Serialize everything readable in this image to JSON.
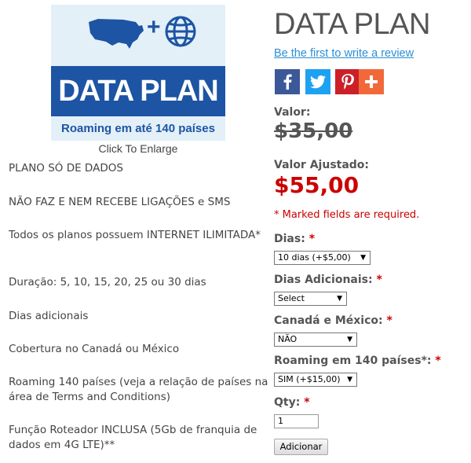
{
  "product_image": {
    "banner_title": "DATA PLAN",
    "banner_subtitle": "Roaming em até 140 países",
    "plus_symbol": "+",
    "enlarge_label": "Click To Enlarge",
    "colors": {
      "blue": "#1d54a4",
      "light_bg": "#e3f0f8"
    }
  },
  "description": [
    "PLANO SÓ DE DADOS",
    "NÃO FAZ E NEM RECEBE LIGAÇÕES e SMS",
    "Todos os planos possuem INTERNET ILIMITADA*",
    "Duração: 5, 10, 15, 20, 25 ou 30 dias",
    "Dias adicionais",
    "Cobertura no Canadá ou México",
    "Roaming 140 países (veja a relação de países na área de Terms and Conditions)",
    "Função Roteador INCLUSA (5Gb de franquia de dados em 4G LTE)**"
  ],
  "product": {
    "title": "DATA PLAN",
    "review_link": "Be the first to write a review"
  },
  "share": [
    {
      "icon": "facebook-icon",
      "color": "#3b5998"
    },
    {
      "icon": "twitter-icon",
      "color": "#1da1f2"
    },
    {
      "icon": "pinterest-icon",
      "color": "#cb2027"
    },
    {
      "icon": "plus-share-icon",
      "color": "#f1693a"
    }
  ],
  "pricing": {
    "valor_label": "Valor:",
    "old_price": "$35,00",
    "adjusted_label": "Valor Ajustado:",
    "new_price": "$55,00"
  },
  "form": {
    "required_note": "* Marked fields are required.",
    "required_mark": "*",
    "dias": {
      "label": "Dias:",
      "value": "10 dias (+$5,00)"
    },
    "dias_adicionais": {
      "label": "Dias Adicionais:",
      "value": "Select"
    },
    "canada_mexico": {
      "label": "Canadá e México:",
      "value": "NÃO"
    },
    "roaming": {
      "label": "Roaming em 140 países*:",
      "value": "SIM (+$15,00)"
    },
    "qty": {
      "label": "Qty:",
      "value": "1"
    },
    "add_button": "Adicionar",
    "arrow": "▼"
  }
}
